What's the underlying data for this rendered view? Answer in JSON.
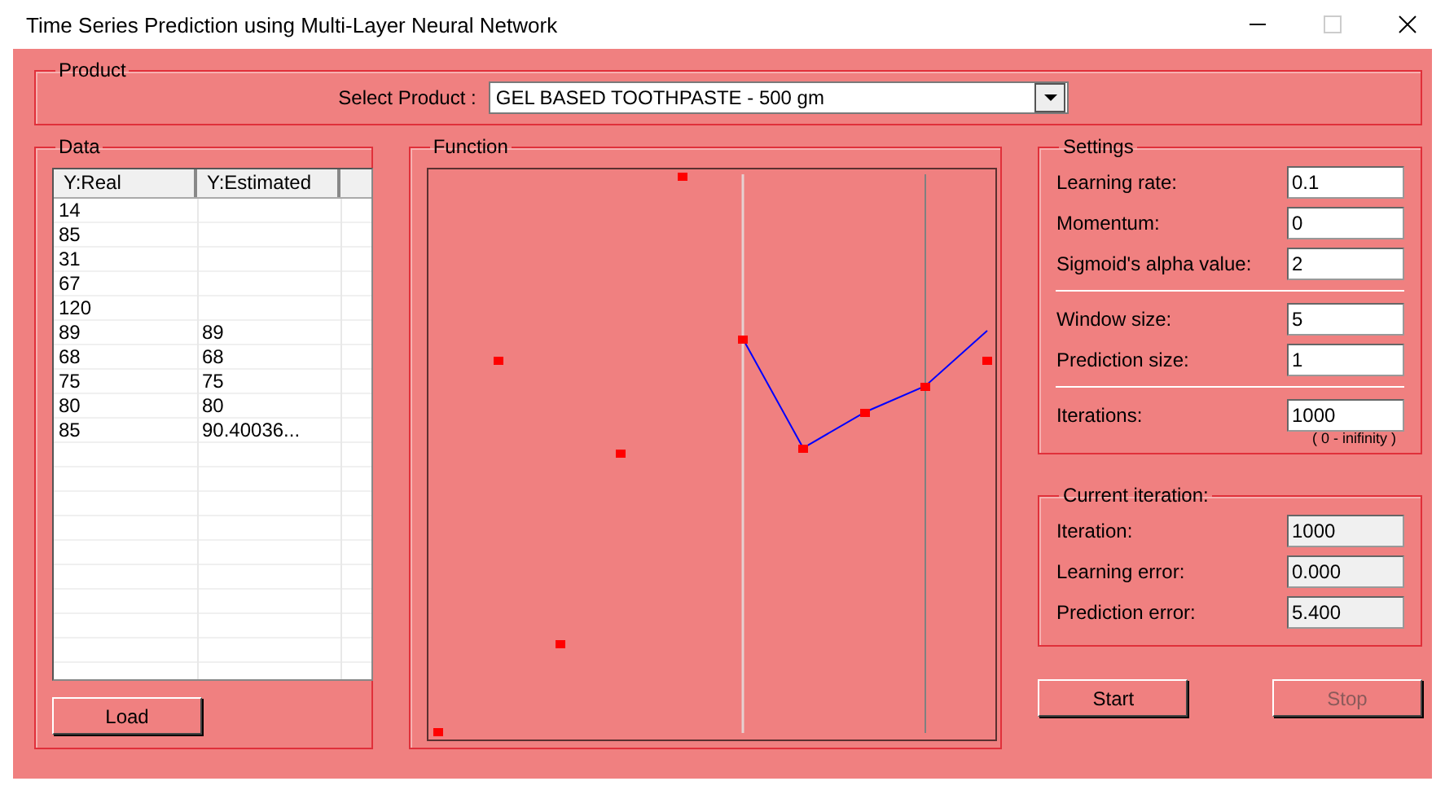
{
  "window": {
    "title": "Time Series Prediction using Multi-Layer Neural Network"
  },
  "product": {
    "title": "Product",
    "label": "Select Product :",
    "value": "GEL BASED TOOTHPASTE - 500 gm"
  },
  "data": {
    "title": "Data",
    "columns": [
      "Y:Real",
      "Y:Estimated"
    ],
    "rows": [
      [
        "14",
        ""
      ],
      [
        "85",
        ""
      ],
      [
        "31",
        ""
      ],
      [
        "67",
        ""
      ],
      [
        "120",
        ""
      ],
      [
        "89",
        "89"
      ],
      [
        "68",
        "68"
      ],
      [
        "75",
        "75"
      ],
      [
        "80",
        "80"
      ],
      [
        "85",
        "90.40036..."
      ]
    ],
    "button": "Load"
  },
  "function": {
    "title": "Function"
  },
  "settings": {
    "title": "Settings",
    "groups": [
      [
        {
          "label": "Learning rate:",
          "value": "0.1"
        },
        {
          "label": "Momentum:",
          "value": "0"
        },
        {
          "label": "Sigmoid's alpha value:",
          "value": "2"
        }
      ],
      [
        {
          "label": "Window size:",
          "value": "5"
        },
        {
          "label": "Prediction size:",
          "value": "1"
        }
      ],
      [
        {
          "label": "Iterations:",
          "value": "1000",
          "hint": "( 0 - inifinity )"
        }
      ]
    ]
  },
  "current": {
    "title": "Current iteration:",
    "fields": [
      {
        "label": "Iteration:",
        "value": "1000"
      },
      {
        "label": "Learning error:",
        "value": "0.000"
      },
      {
        "label": "Prediction error:",
        "value": "5.400"
      }
    ]
  },
  "buttons": [
    {
      "label": "Start",
      "disabled": false
    },
    {
      "label": "Stop",
      "disabled": true
    }
  ]
}
